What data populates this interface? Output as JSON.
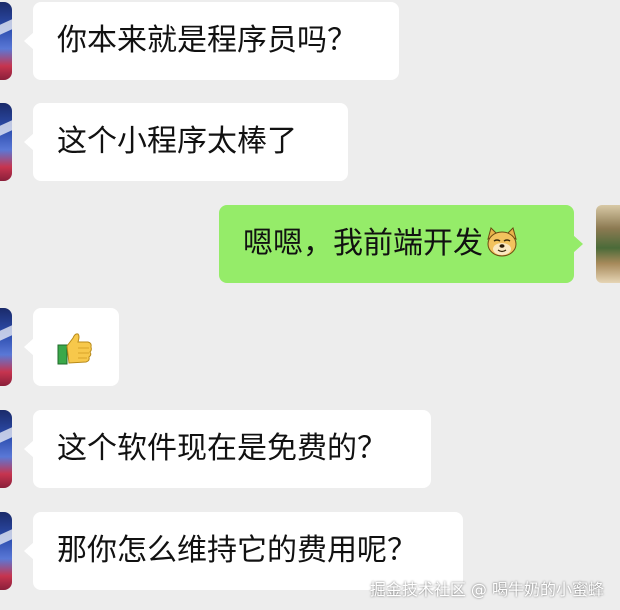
{
  "messages": [
    {
      "side": "in",
      "text": "你本来就是程序员吗？"
    },
    {
      "side": "in",
      "text": "这个小程序太棒了"
    },
    {
      "side": "out",
      "text": "嗯嗯，我前端开发",
      "emoji": "doge-icon"
    },
    {
      "side": "in",
      "text": "",
      "emoji": "thumbs-up-icon"
    },
    {
      "side": "in",
      "text": "这个软件现在是免费的？"
    },
    {
      "side": "in",
      "text": "那你怎么维持它的费用呢？"
    }
  ],
  "watermark": "掘金技术社区 @ 喝牛奶的小蜜蜂",
  "colors": {
    "background": "#ededed",
    "incoming_bubble": "#ffffff",
    "outgoing_bubble": "#95ec69"
  }
}
